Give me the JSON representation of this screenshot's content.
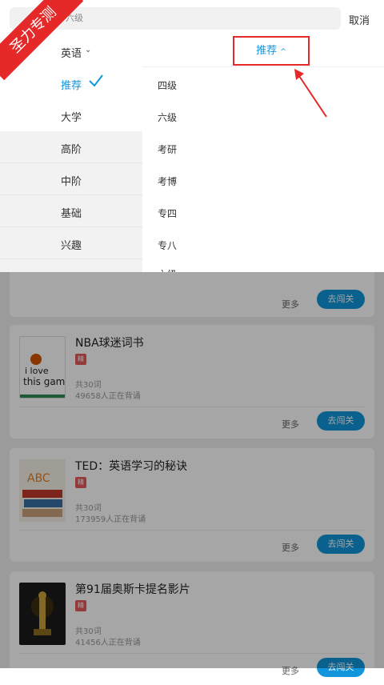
{
  "search": {
    "placeholder": "六级"
  },
  "topbar": {
    "cancel_label": "取消"
  },
  "panel": {
    "language": "英语",
    "categories": [
      "推荐",
      "大学",
      "高阶",
      "中阶",
      "基础",
      "兴趣"
    ],
    "active_tab": "推荐",
    "subcategories": [
      "四级",
      "六级",
      "考研",
      "考博",
      "专四",
      "专八",
      "六级"
    ]
  },
  "cards": [
    {
      "title": "",
      "tag": "",
      "words": "",
      "learners": "",
      "more": "更多",
      "button": "去闯关"
    },
    {
      "title": "NBA球迷词书",
      "tag": "精",
      "words": "共30词",
      "learners": "49658人正在背诵",
      "more": "更多",
      "button": "去闯关"
    },
    {
      "title": "TED：英语学习的秘诀",
      "tag": "精",
      "words": "共30词",
      "learners": "173959人正在背诵",
      "more": "更多",
      "button": "去闯关"
    },
    {
      "title": "第91届奥斯卡提名影片",
      "tag": "精",
      "words": "共30词",
      "learners": "41456人正在背诵",
      "more": "更多",
      "button": "去闯关"
    }
  ],
  "watermark": "圣力专测",
  "colors": {
    "accent": "#1296db",
    "highlight": "#e52929"
  }
}
